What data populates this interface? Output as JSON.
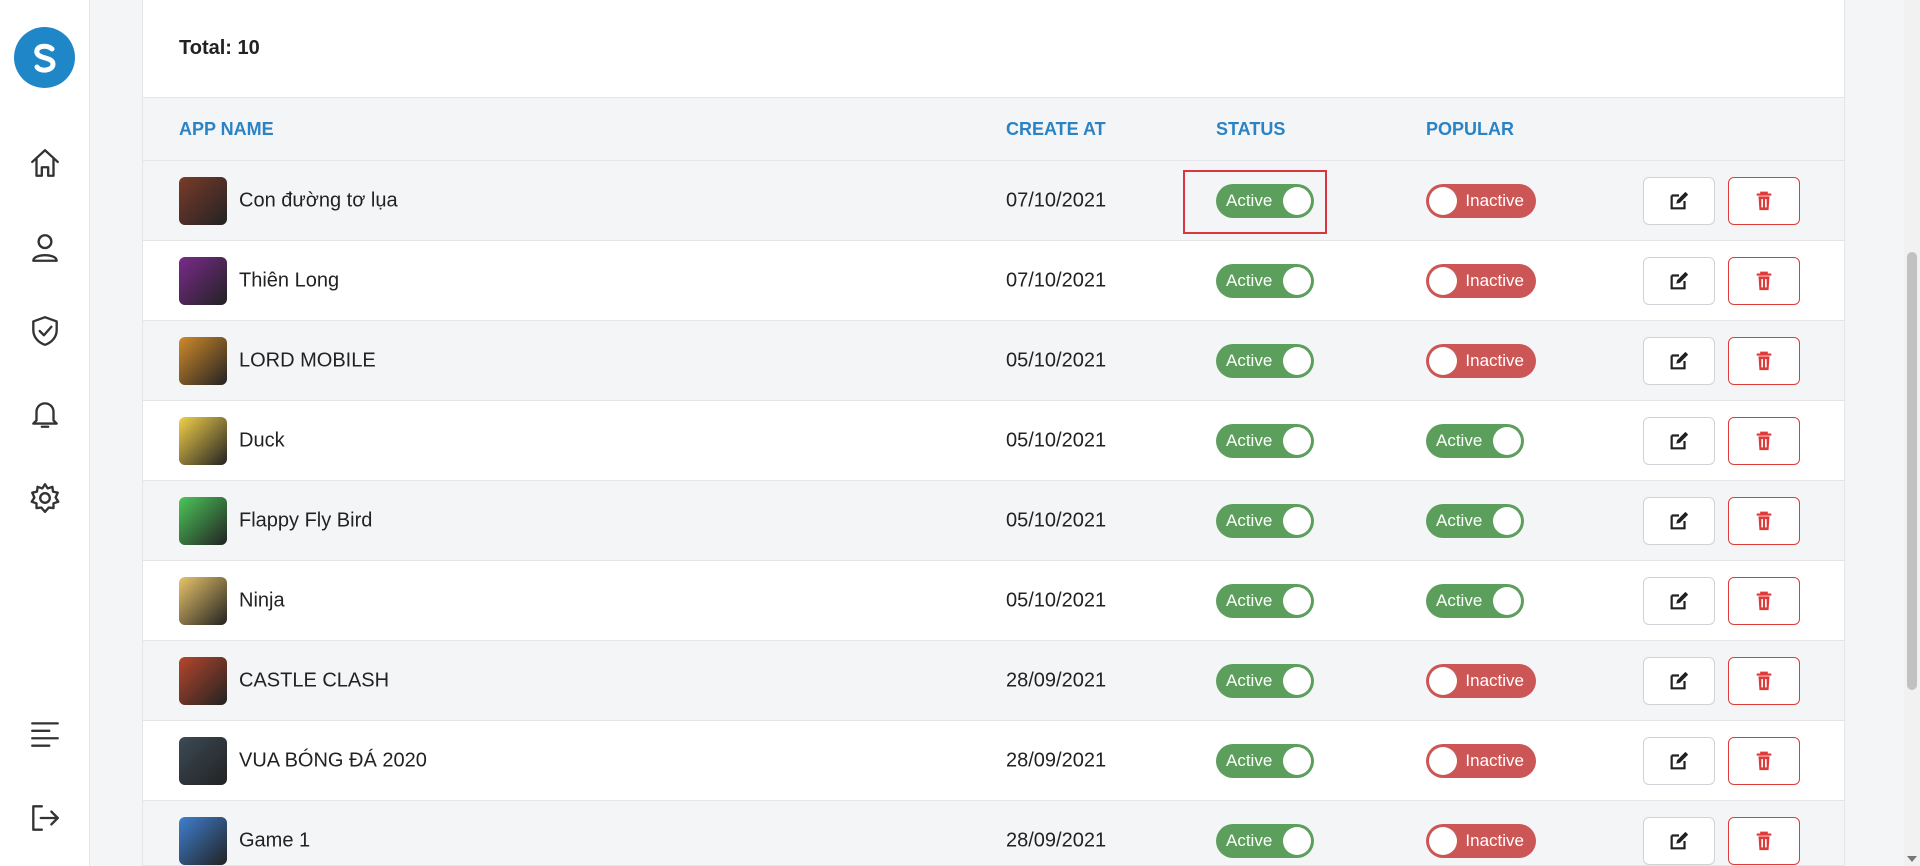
{
  "sidebar": {
    "logo": "app-logo",
    "items": [
      {
        "icon": "home-icon"
      },
      {
        "icon": "user-icon"
      },
      {
        "icon": "shield-check-icon"
      },
      {
        "icon": "bell-icon"
      },
      {
        "icon": "gear-icon"
      },
      {
        "icon": "menu-lines-icon"
      },
      {
        "icon": "logout-icon"
      }
    ]
  },
  "summary": {
    "total_label": "Total: 10"
  },
  "table": {
    "headers": {
      "app_name": "APP NAME",
      "create_at": "CREATE AT",
      "status": "STATUS",
      "popular": "POPULAR"
    },
    "rows": [
      {
        "name": "Con đường tơ lụa",
        "date": "07/10/2021",
        "status": "Active",
        "popular": "Inactive",
        "thumb_color": "#7a3b2a"
      },
      {
        "name": "Thiên Long",
        "date": "07/10/2021",
        "status": "Active",
        "popular": "Inactive",
        "thumb_color": "#7a2a8c"
      },
      {
        "name": "LORD MOBILE",
        "date": "05/10/2021",
        "status": "Active",
        "popular": "Inactive",
        "thumb_color": "#d08a2a"
      },
      {
        "name": "Duck",
        "date": "05/10/2021",
        "status": "Active",
        "popular": "Active",
        "thumb_color": "#f2d04a"
      },
      {
        "name": "Flappy Fly Bird",
        "date": "05/10/2021",
        "status": "Active",
        "popular": "Active",
        "thumb_color": "#4cc75a"
      },
      {
        "name": "Ninja",
        "date": "05/10/2021",
        "status": "Active",
        "popular": "Active",
        "thumb_color": "#e9c46a"
      },
      {
        "name": "CASTLE CLASH",
        "date": "28/09/2021",
        "status": "Active",
        "popular": "Inactive",
        "thumb_color": "#b5462c"
      },
      {
        "name": "VUA BÓNG ĐÁ 2020",
        "date": "28/09/2021",
        "status": "Active",
        "popular": "Inactive",
        "thumb_color": "#3c4a55"
      },
      {
        "name": "Game 1",
        "date": "28/09/2021",
        "status": "Active",
        "popular": "Inactive",
        "thumb_color": "#3f7fd0"
      }
    ]
  },
  "colors": {
    "accent": "#2a83c4",
    "active": "#5c9e5c",
    "inactive": "#cc5555",
    "danger": "#e03b3b"
  }
}
